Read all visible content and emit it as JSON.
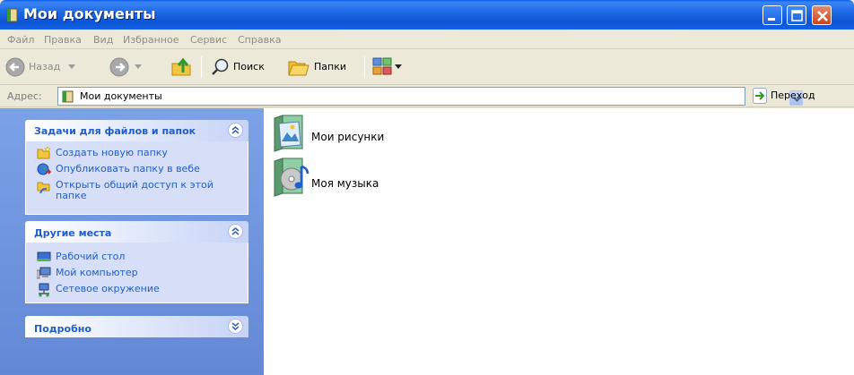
{
  "window": {
    "title": "Мои документы"
  },
  "menu": [
    "Файл",
    "Правка",
    "Вид",
    "Избранное",
    "Сервис",
    "Справка"
  ],
  "toolbar": {
    "back_label": "Назад",
    "search_label": "Поиск",
    "folders_label": "Папки"
  },
  "address": {
    "label": "Адрес:",
    "value": "Мои документы",
    "go_label": "Переход"
  },
  "panels": {
    "tasks": {
      "title": "Задачи для файлов и папок",
      "items": [
        {
          "label": "Создать новую папку",
          "icon": "new-folder-icon"
        },
        {
          "label": "Опубликовать папку в вебе",
          "icon": "publish-web-icon"
        },
        {
          "label_line1": "Открыть общий доступ к этой",
          "label_line2": "папке",
          "icon": "share-folder-icon"
        }
      ]
    },
    "places": {
      "title": "Другие места",
      "items": [
        {
          "label": "Рабочий стол",
          "icon": "desktop-icon"
        },
        {
          "label": "Мой компьютер",
          "icon": "my-computer-icon"
        },
        {
          "label": "Сетевое окружение",
          "icon": "network-icon"
        }
      ]
    },
    "details": {
      "title": "Подробно"
    }
  },
  "files": [
    {
      "name": "Мои рисунки",
      "icon": "my-pictures-folder-icon"
    },
    {
      "name": "Моя музыка",
      "icon": "my-music-folder-icon"
    }
  ],
  "colors": {
    "titlebar": "#0b55d6",
    "task_text": "#215dc6",
    "left_pane": "#7ba2e7",
    "panel_body": "#d6dff7"
  }
}
